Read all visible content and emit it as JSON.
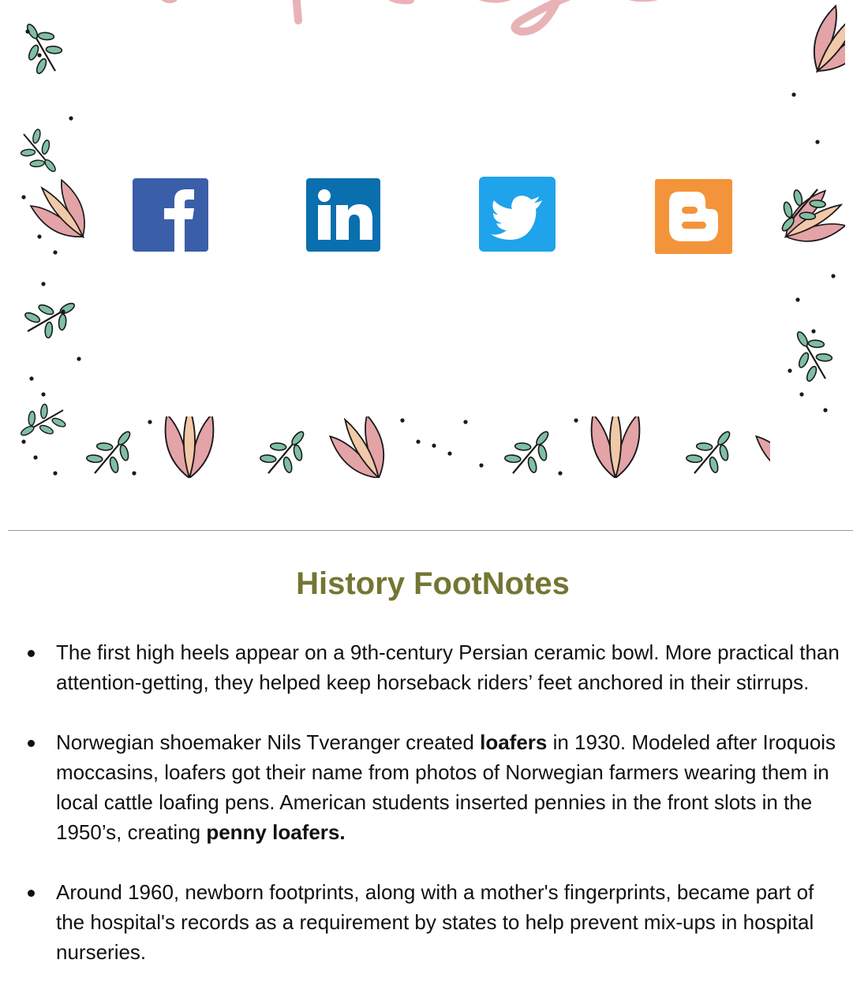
{
  "banner": {
    "script_title": "Thank you",
    "social": [
      {
        "name": "Facebook",
        "glyph": "f",
        "color": "#3b5ea8"
      },
      {
        "name": "LinkedIn",
        "glyph": "in",
        "color": "#0a6fae"
      },
      {
        "name": "Twitter",
        "glyph": "bird",
        "color": "#1fa3ea"
      },
      {
        "name": "Blogger",
        "glyph": "B",
        "color": "#f4943a"
      }
    ],
    "colors": {
      "leaf": "#7fbfa3",
      "petal_pink": "#e3a3a7",
      "petal_peach": "#f2c9a8",
      "outline": "#1a1a1a",
      "script": "#e8b3b6"
    }
  },
  "section": {
    "title": "History FootNotes",
    "title_color": "#747633"
  },
  "facts": [
    {
      "parts": [
        {
          "text": "The first high heels appear on a 9th-century Persian ceramic bowl. More practical than attention-getting, they helped keep horseback riders’ feet anchored in their stirrups.",
          "bold": false
        }
      ]
    },
    {
      "parts": [
        {
          "text": "Norwegian shoemaker Nils Tveranger created ",
          "bold": false
        },
        {
          "text": "loafers",
          "bold": true
        },
        {
          "text": " in 1930.  Modeled after Iroquois moccasins, loafers got their name from photos of Norwegian farmers wearing them in local cattle loafing pens.  American students inserted pennies in the front slots in the 1950’s, creating ",
          "bold": false
        },
        {
          "text": "penny loafers.",
          "bold": true
        }
      ]
    },
    {
      "parts": [
        {
          "text": "Around 1960, newborn footprints, along with a mother's fingerprints, became part of the hospital's records as a requirement by states to help prevent mix-ups in hospital nurseries.",
          "bold": false
        }
      ]
    }
  ]
}
